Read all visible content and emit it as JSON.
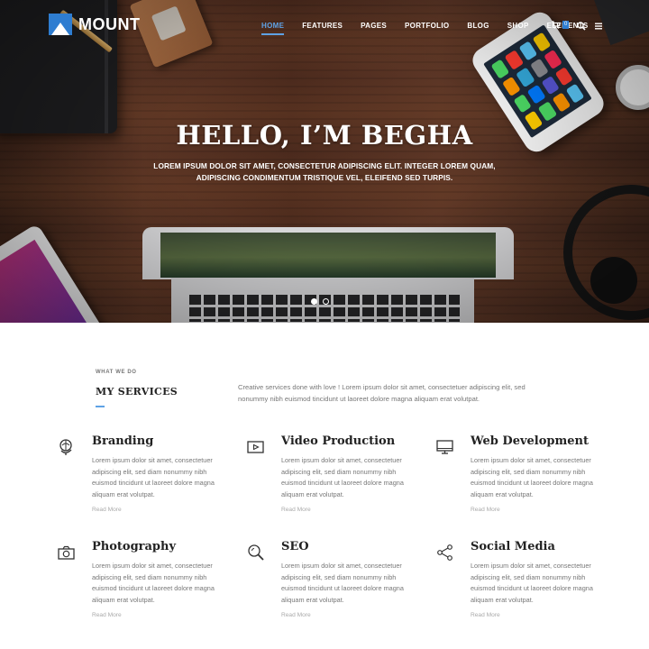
{
  "brand": {
    "name": "MOUNT"
  },
  "nav": {
    "items": [
      "HOME",
      "FEATURES",
      "PAGES",
      "PORTFOLIO",
      "BLOG",
      "SHOP",
      "ELEMENTS"
    ],
    "active": "HOME",
    "cart_count": "0"
  },
  "hero": {
    "title": "HELLO, I’M BEGHA",
    "subtitle_line1": "LOREM IPSUM DOLOR SIT AMET, CONSECTETUR ADIPISCING ELIT. INTEGER LOREM QUAM,",
    "subtitle_line2": "ADIPISCING CONDIMENTUM TRISTIQUE VEL, ELEIFEND SED TURPIS.",
    "slide_count": 2,
    "active_slide": 1
  },
  "services": {
    "eyebrow": "WHAT WE DO",
    "title": "MY SERVICES",
    "intro": "Creative services done with love ! Lorem ipsum dolor sit amet, consectetuer adipiscing elit, sed nonummy nibh euismod tincidunt ut laoreet dolore magna aliquam erat volutpat.",
    "items": [
      {
        "title": "Branding",
        "icon": "globe-icon",
        "text": "Lorem ipsum dolor sit amet, consectetuer adipiscing elit, sed diam nonummy nibh euismod tincidunt ut laoreet dolore magna aliquam erat volutpat.",
        "link": "Read More"
      },
      {
        "title": "Video Production",
        "icon": "video-icon",
        "text": "Lorem ipsum dolor sit amet, consectetuer adipiscing elit, sed diam nonummy nibh euismod tincidunt ut laoreet dolore magna aliquam erat volutpat.",
        "link": "Read More"
      },
      {
        "title": "Web Development",
        "icon": "monitor-icon",
        "text": "Lorem ipsum dolor sit amet, consectetuer adipiscing elit, sed diam nonummy nibh euismod tincidunt ut laoreet dolore magna aliquam erat volutpat.",
        "link": "Read More"
      },
      {
        "title": "Photography",
        "icon": "camera-icon",
        "text": "Lorem ipsum dolor sit amet, consectetuer adipiscing elit, sed diam nonummy nibh euismod tincidunt ut laoreet dolore magna aliquam erat volutpat.",
        "link": "Read More"
      },
      {
        "title": "SEO",
        "icon": "search-icon",
        "text": "Lorem ipsum dolor sit amet, consectetuer adipiscing elit, sed diam nonummy nibh euismod tincidunt ut laoreet dolore magna aliquam erat volutpat.",
        "link": "Read More"
      },
      {
        "title": "Social Media",
        "icon": "share-icon",
        "text": "Lorem ipsum dolor sit amet, consectetuer adipiscing elit, sed diam nonummy nibh euismod tincidunt ut laoreet dolore magna aliquam erat volutpat.",
        "link": "Read More"
      }
    ]
  },
  "colors": {
    "accent": "#5ea2e5",
    "brand_blue": "#2e7dd1",
    "body_text": "#777777",
    "heading": "#222222"
  }
}
